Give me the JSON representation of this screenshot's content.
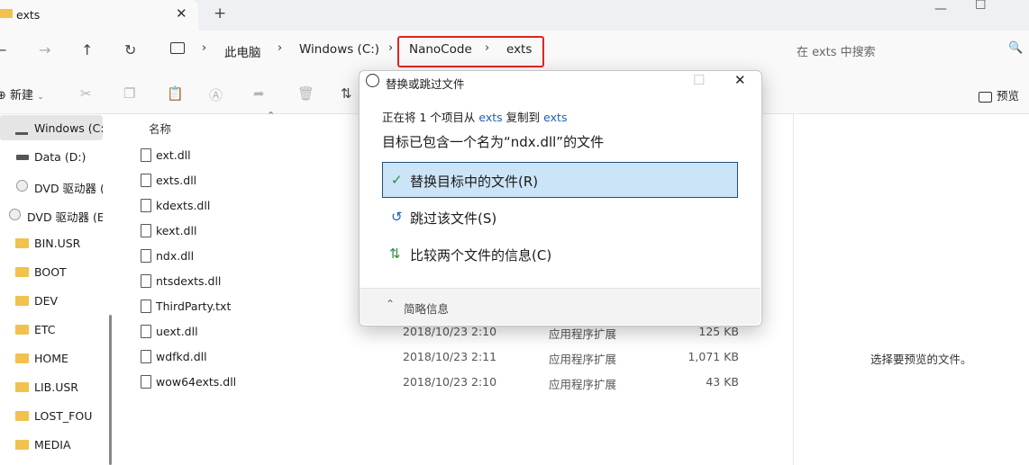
{
  "window": {
    "tab_title": "exts",
    "tab_close": "✕",
    "tab_add": "+",
    "min": "—",
    "max": "☐",
    "close": "✕"
  },
  "nav": {
    "back": "←",
    "forward": "→",
    "up": "↑",
    "refresh": "↻",
    "breadcrumb": [
      "此电脑",
      "Windows (C:)",
      "NanoCode",
      "exts"
    ],
    "sep": "›",
    "search_placeholder": "在 exts 中搜索",
    "search_icon": "🔍"
  },
  "commands": {
    "new_label": "新建",
    "preview_label": "预览"
  },
  "sidebar": {
    "items": [
      {
        "label": "Windows (C:)",
        "type": "drive"
      },
      {
        "label": "Data (D:)",
        "type": "drive"
      },
      {
        "label": "DVD 驱动器 (I",
        "type": "disc"
      },
      {
        "label": "DVD 驱动器 (E:",
        "type": "disc"
      },
      {
        "label": "BIN.USR",
        "type": "folder"
      },
      {
        "label": "BOOT",
        "type": "folder"
      },
      {
        "label": "DEV",
        "type": "folder"
      },
      {
        "label": "ETC",
        "type": "folder"
      },
      {
        "label": "HOME",
        "type": "folder"
      },
      {
        "label": "LIB.USR",
        "type": "folder"
      },
      {
        "label": "LOST_FOU",
        "type": "folder"
      },
      {
        "label": "MEDIA",
        "type": "folder"
      }
    ]
  },
  "files": {
    "column_name": "名称",
    "rows": [
      {
        "name": "ext.dll",
        "date": "",
        "type": "",
        "size": ""
      },
      {
        "name": "exts.dll",
        "date": "",
        "type": "",
        "size": ""
      },
      {
        "name": "kdexts.dll",
        "date": "",
        "type": "",
        "size": ""
      },
      {
        "name": "kext.dll",
        "date": "",
        "type": "",
        "size": ""
      },
      {
        "name": "ndx.dll",
        "date": "",
        "type": "",
        "size": ""
      },
      {
        "name": "ntsdexts.dll",
        "date": "",
        "type": "",
        "size": ""
      },
      {
        "name": "ThirdParty.txt",
        "date": "",
        "type": "",
        "size": ""
      },
      {
        "name": "uext.dll",
        "date": "2018/10/23 2:10",
        "type": "应用程序扩展",
        "size": "125 KB"
      },
      {
        "name": "wdfkd.dll",
        "date": "2018/10/23 2:11",
        "type": "应用程序扩展",
        "size": "1,071 KB"
      },
      {
        "name": "wow64exts.dll",
        "date": "2018/10/23 2:10",
        "type": "应用程序扩展",
        "size": "43 KB"
      }
    ]
  },
  "preview_pane": {
    "message": "选择要预览的文件。"
  },
  "dialog": {
    "title": "替换或跳过文件",
    "copy_prefix": "正在将 1 个项目从",
    "copy_source": "exts",
    "copy_middle": "复制到",
    "copy_dest": "exts",
    "message": "目标已包含一个名为“ndx.dll”的文件",
    "options": [
      {
        "icon": "✓",
        "label": "替换目标中的文件(R)"
      },
      {
        "icon": "↺",
        "label": "跳过该文件(S)"
      },
      {
        "icon": "⇅",
        "label": "比较两个文件的信息(C)"
      }
    ],
    "details_label": "简略信息",
    "details_chevron": "⌃",
    "close": "✕",
    "max": "☐"
  },
  "colors": {
    "accent": "#1c62b9",
    "highlight": "#cce4f7",
    "folder": "#f2c14e",
    "annotation": "#e0261f"
  }
}
